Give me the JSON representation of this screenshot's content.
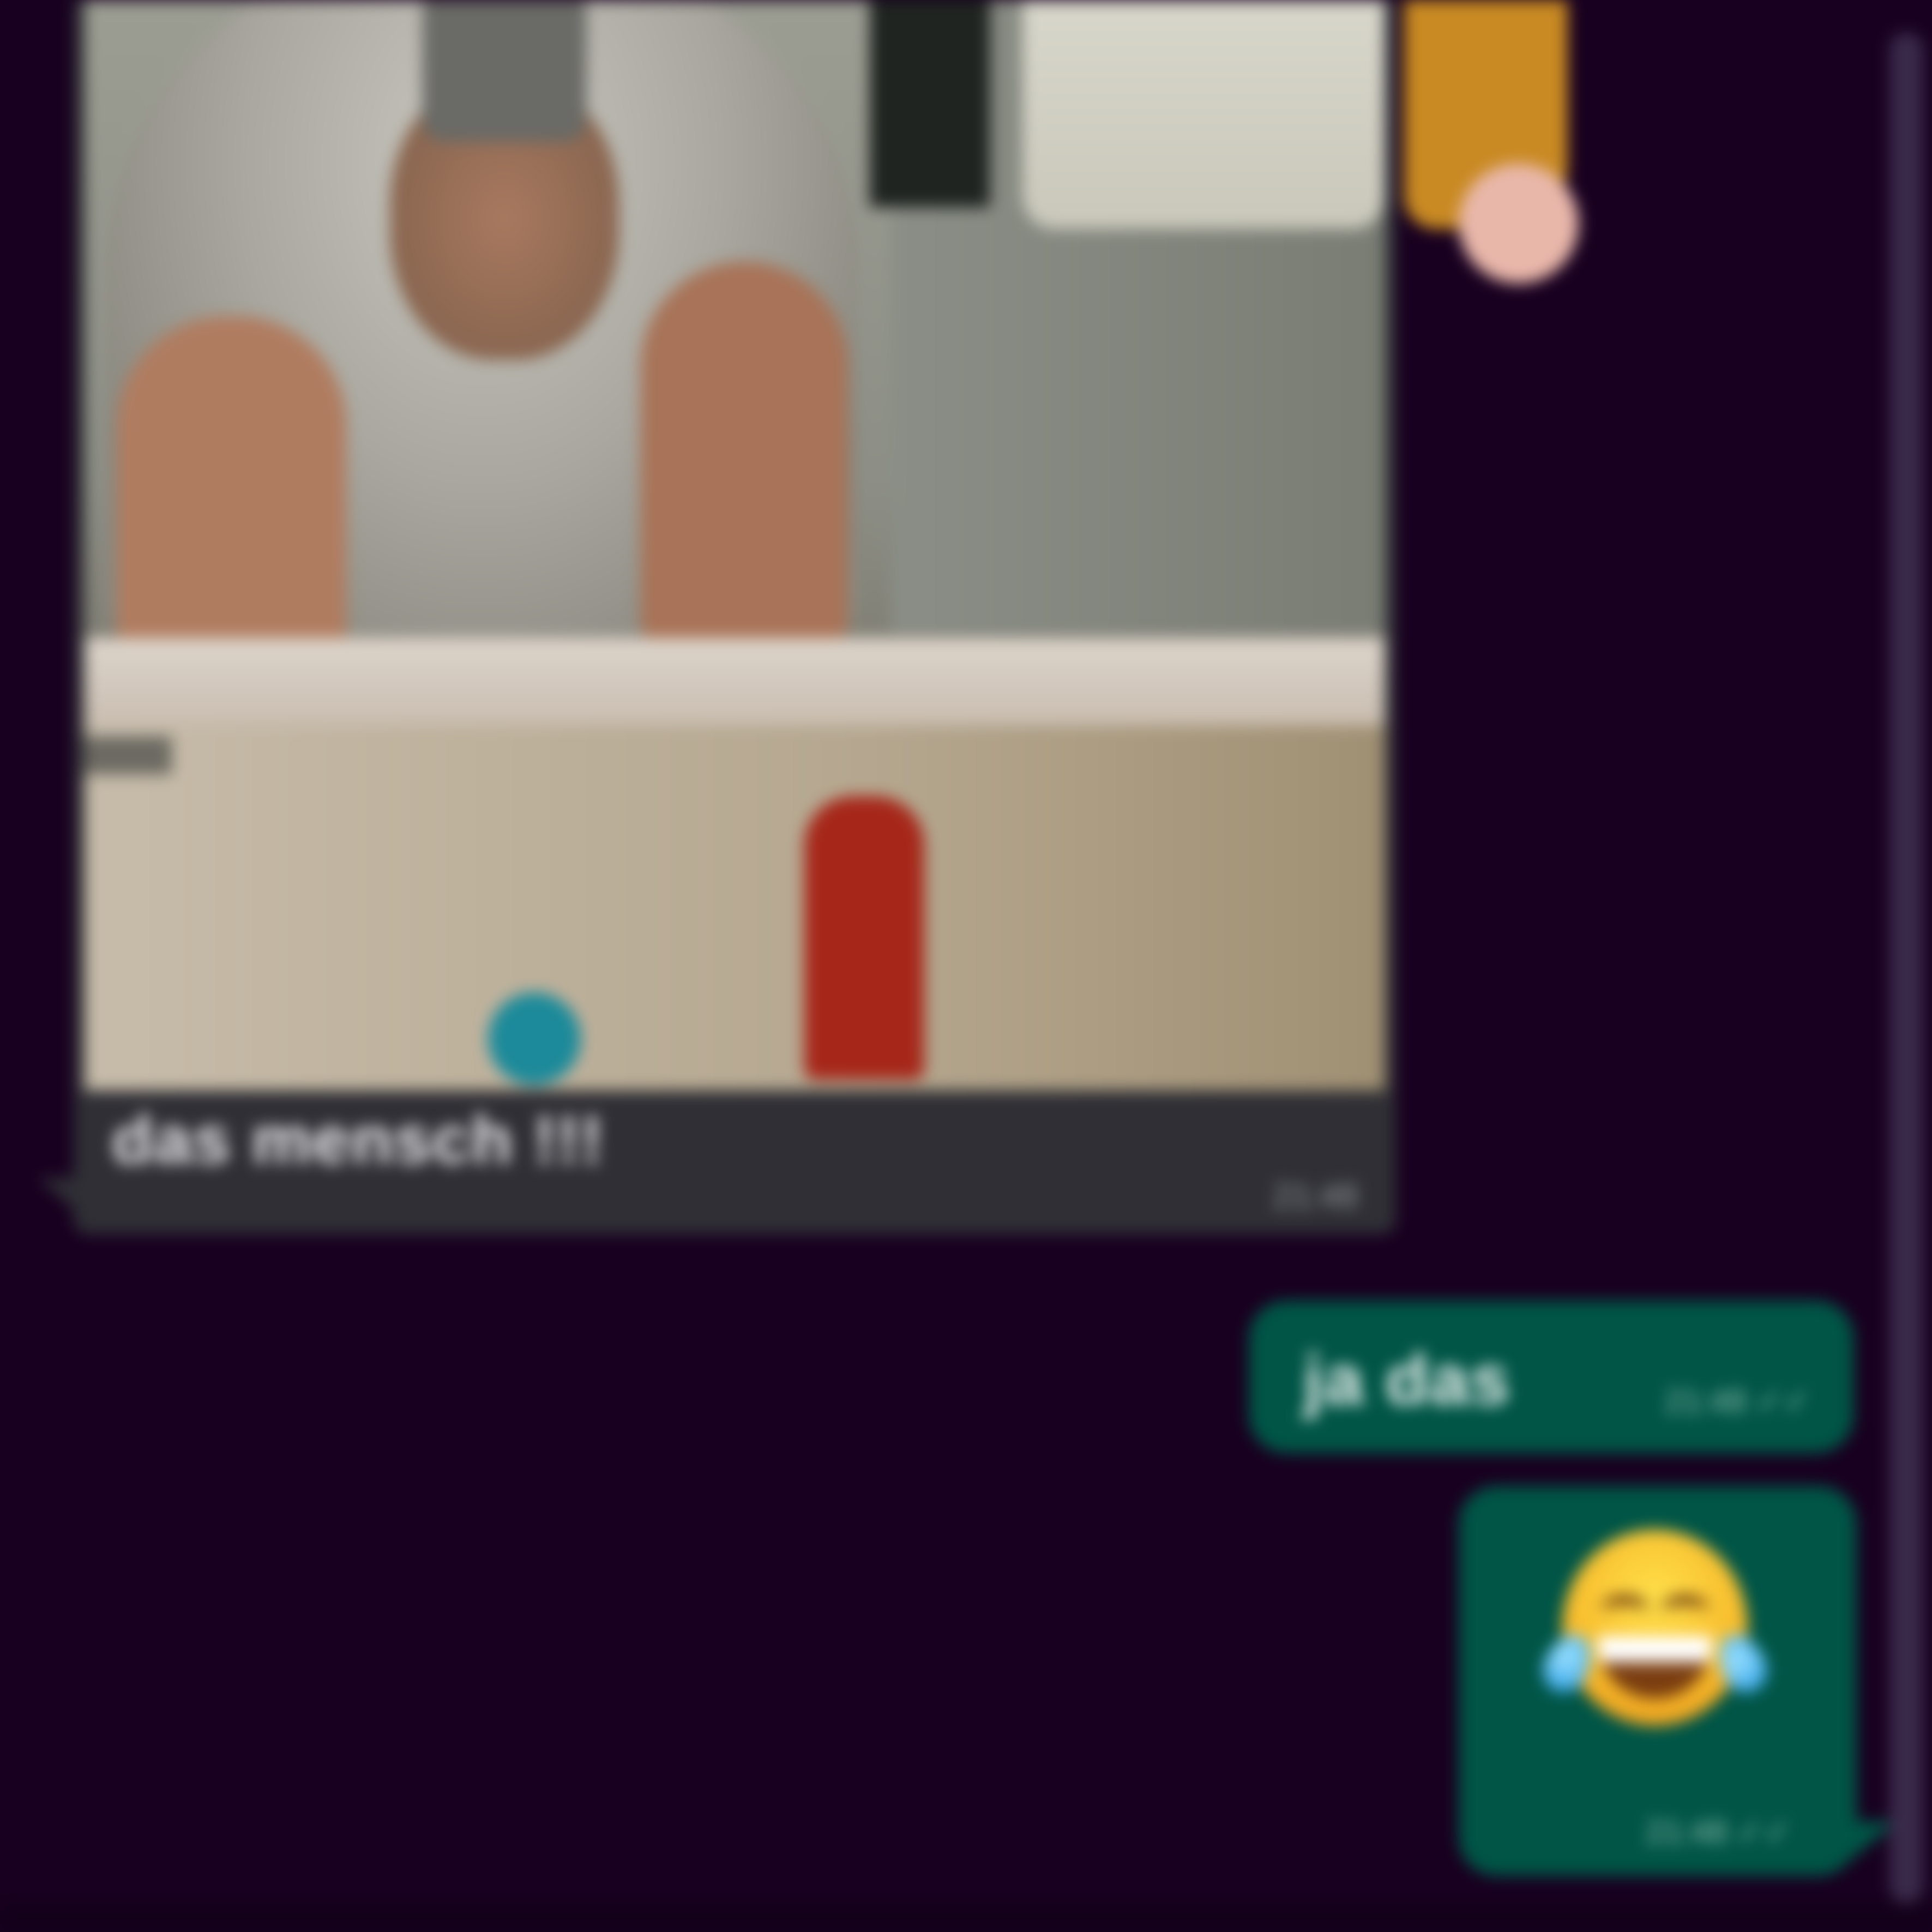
{
  "chat": {
    "incoming_image_message": {
      "caption": "das mensch !!!",
      "time": "21:48"
    },
    "outgoing_messages": [
      {
        "text": "ja das",
        "time": "21:48",
        "status": "read"
      },
      {
        "emoji": "😂",
        "emoji_name": "face-with-tears-of-joy",
        "time": "21:48",
        "status": "read"
      }
    ]
  },
  "colors": {
    "background": "#180020",
    "incoming_bubble": "#2f2f35",
    "outgoing_bubble": "#005546",
    "scrollbar": "#3a2a4a"
  },
  "icons": {
    "read_receipt": "double-check-icon"
  }
}
